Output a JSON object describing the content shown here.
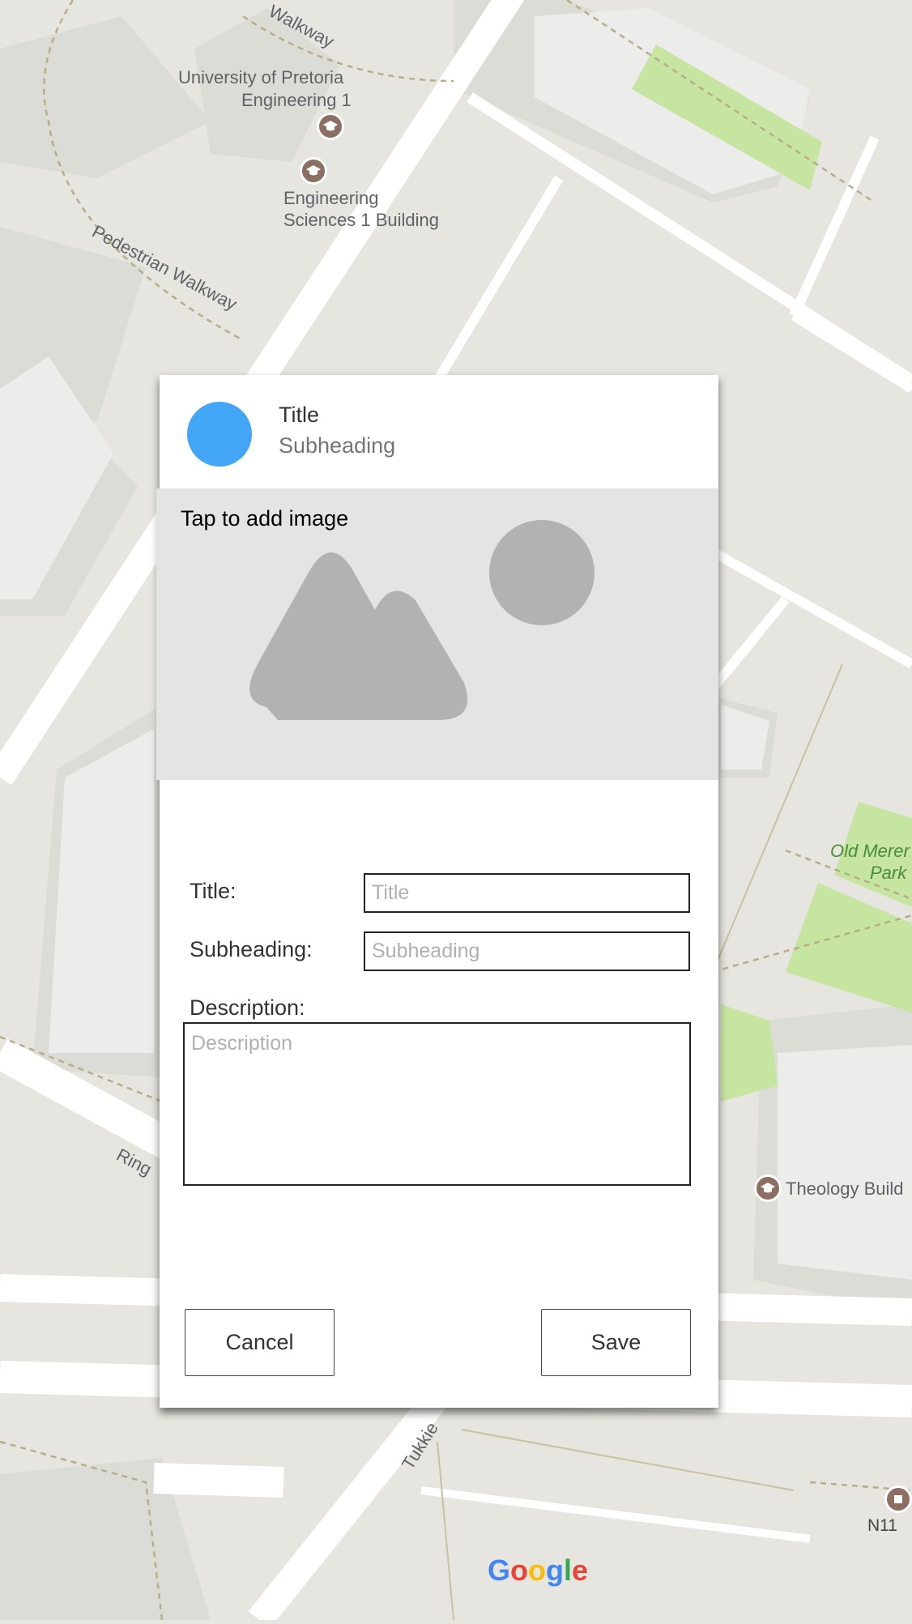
{
  "map": {
    "labels": {
      "walkway_top": "Walkway",
      "univ_line1": "University of Pretoria",
      "univ_line2": "Engineering 1",
      "eng_line1": "Engineering",
      "eng_line2": "Sciences 1 Building",
      "pedestrian": "Pedestrian Walkway",
      "ring": "Ring",
      "park_line1": "Old Merer",
      "park_line2": "Park",
      "theology": "Theology Build",
      "tukkie": "Tukkie",
      "n11": "N11",
      "google": "Google"
    },
    "icons": [
      "graduation-cap-icon",
      "graduation-cap-icon",
      "graduation-cap-icon",
      "bus-stop-icon"
    ],
    "colors": {
      "background": "#e6e5df",
      "road": "#ffffff",
      "park": "#c5e5a0",
      "poi": "#8d6e63"
    }
  },
  "dialog": {
    "header": {
      "title": "Title",
      "subheading": "Subheading"
    },
    "avatar_color": "#42a5f5",
    "image": {
      "prompt": "Tap to add image",
      "icon": "image-placeholder-icon"
    },
    "form": {
      "title_label": "Title:",
      "title_placeholder": "Title",
      "title_value": "",
      "subheading_label": "Subheading:",
      "subheading_placeholder": "Subheading",
      "subheading_value": "",
      "description_label": "Description:",
      "description_placeholder": "Description",
      "description_value": ""
    },
    "actions": {
      "cancel": "Cancel",
      "save": "Save"
    }
  }
}
